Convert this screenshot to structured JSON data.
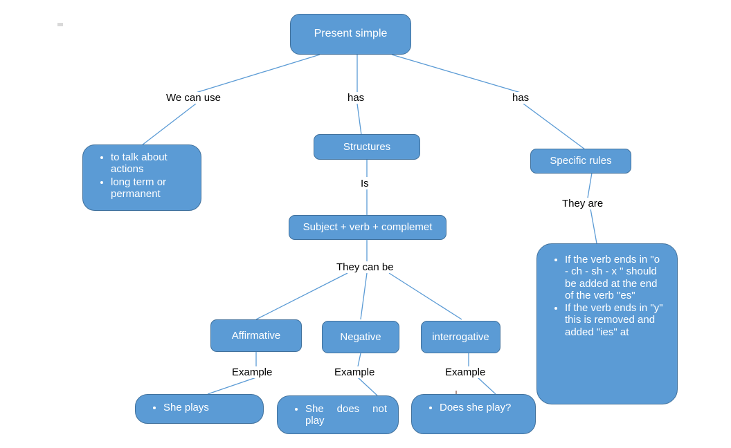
{
  "diagram": {
    "title_node": {
      "label": "Present simple"
    },
    "nodes": {
      "uses": {
        "bullets": [
          "to talk about actions",
          "long term or permanent"
        ]
      },
      "structures": {
        "label": "Structures"
      },
      "formula": {
        "label": "Subject + verb + complemet"
      },
      "specific_rules": {
        "label": "Specific rules"
      },
      "rules_list": {
        "bullets": [
          "If the verb ends in \"o - ch - sh - x \" should be added at the end of the verb \"es\"",
          "If the verb ends in \"y\" this is removed and added \"ies\" at"
        ]
      },
      "affirmative": {
        "label": "Affirmative"
      },
      "negative": {
        "label": "Negative"
      },
      "interrogative": {
        "label": "interrogative"
      },
      "example_affirmative": {
        "bullets": [
          "She plays"
        ]
      },
      "example_negative": {
        "bullets": [
          "She does not play"
        ]
      },
      "example_interrogative": {
        "bullets": [
          "Does she play?"
        ]
      }
    },
    "edge_labels": {
      "we_can_use": "We can use",
      "has_middle": "has",
      "has_right": "has",
      "is": "Is",
      "they_can_be": "They can be",
      "they_are": "They are",
      "example_affirmative": "Example",
      "example_negative": "Example",
      "example_interrogative": "Example"
    },
    "colors": {
      "node_fill": "#5b9bd5",
      "node_border": "#41719c",
      "connector": "#5b9bd5",
      "text_on_node": "#ffffff",
      "label_text": "#000000",
      "background": "#ffffff"
    }
  }
}
